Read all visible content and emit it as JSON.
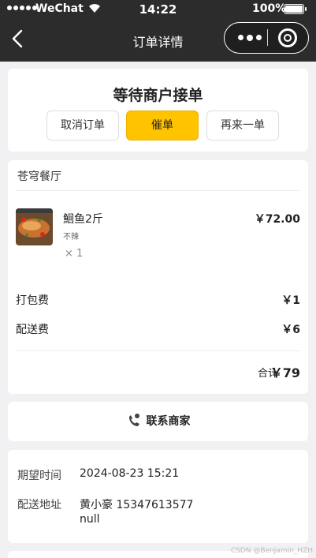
{
  "status_bar": {
    "carrier": "WeChat",
    "time": "14:22",
    "battery": "100%"
  },
  "nav": {
    "title": "订单详情"
  },
  "order_status": {
    "title": "等待商户接单",
    "cancel_label": "取消订单",
    "urge_label": "催单",
    "reorder_label": "再来一单"
  },
  "order": {
    "shop_name": "苍穹餐厅",
    "items": [
      {
        "name": "鮰鱼2斤",
        "spec": "不辣",
        "quantity": "× 1",
        "price": "￥72.00"
      }
    ],
    "packing_label": "打包费",
    "packing_fee": "￥1",
    "delivery_label": "配送费",
    "delivery_fee": "￥6",
    "total_label": "合计",
    "total": "￥79"
  },
  "contact": {
    "label": "联系商家"
  },
  "info": {
    "expected_time_label": "期望时间",
    "expected_time": "2024-08-23 15:21",
    "address_label": "配送地址",
    "recipient": "黄小豪  15347613577",
    "address": "null"
  },
  "watermark": "CSDN @Benjamin_HZH",
  "colors": {
    "header_bg": "#2c2c2c",
    "accent": "#ffc300",
    "page_bg": "#f1f1f3"
  }
}
